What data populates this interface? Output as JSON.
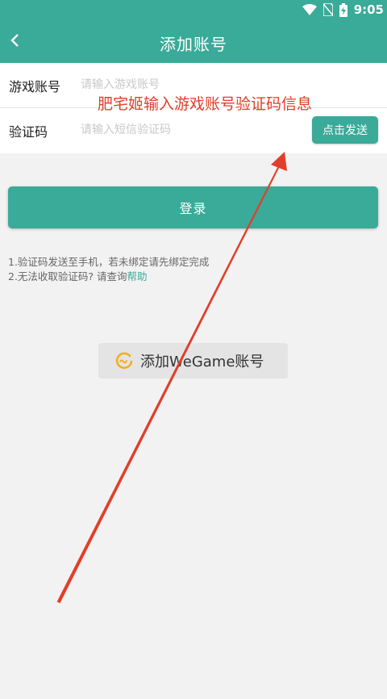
{
  "status_bar": {
    "time": "9:05"
  },
  "header": {
    "title": "添加账号"
  },
  "form": {
    "account": {
      "label": "游戏账号",
      "placeholder": "请输入游戏账号"
    },
    "code": {
      "label": "验证码",
      "placeholder": "请输入短信验证码",
      "send_label": "点击发送"
    }
  },
  "login_label": "登录",
  "tips": {
    "line1": "1.验证码发送至手机，若未绑定请先绑定完成",
    "line2_prefix": "2.无法收取验证码? 请查询",
    "help_link": "帮助"
  },
  "wegame_button": {
    "label": "添加WeGame账号"
  },
  "annotation": {
    "text": "肥宅姬输入游戏账号验证码信息",
    "color": "#e03f2b"
  },
  "colors": {
    "accent": "#3aaa99",
    "background": "#f2f2f2"
  },
  "icons": [
    "wifi-icon",
    "no-sim-icon",
    "battery-charging-icon",
    "back-arrow-icon",
    "wegame-logo-icon"
  ]
}
